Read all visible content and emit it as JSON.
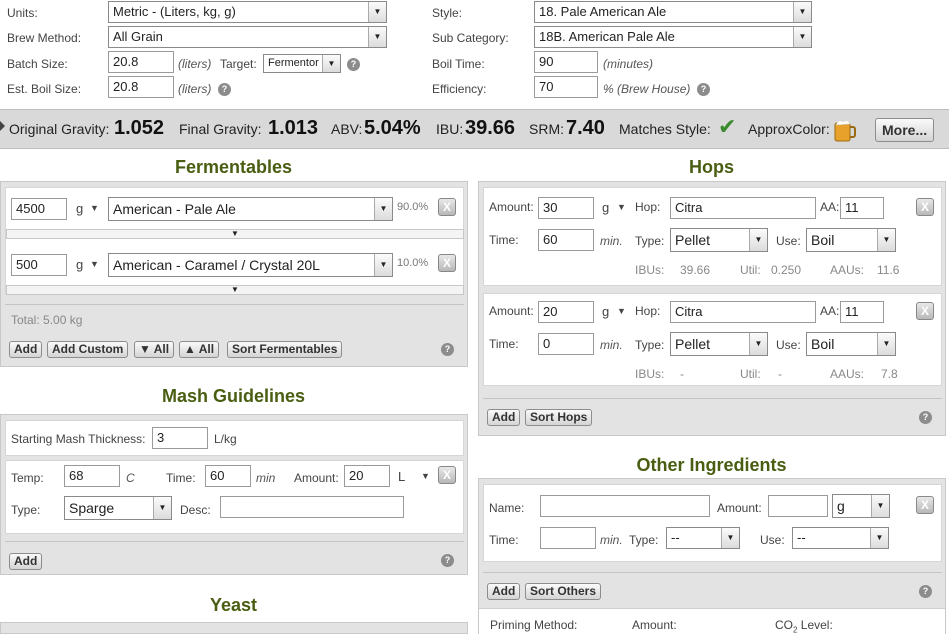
{
  "settings": {
    "units_label": "Units:",
    "units_value": "Metric - (Liters, kg, g)",
    "brew_method_label": "Brew Method:",
    "brew_method_value": "All Grain",
    "batch_size_label": "Batch Size:",
    "batch_size_value": "20.8",
    "batch_size_unit": "(liters)",
    "target_label": "Target:",
    "target_value": "Fermentor",
    "boil_size_label": "Est. Boil Size:",
    "boil_size_value": "20.8",
    "boil_size_unit": "(liters)",
    "style_label": "Style:",
    "style_value": "18. Pale American Ale",
    "subcategory_label": "Sub Category:",
    "subcategory_value": "18B. American Pale Ale",
    "boil_time_label": "Boil Time:",
    "boil_time_value": "90",
    "boil_time_unit": "(minutes)",
    "efficiency_label": "Efficiency:",
    "efficiency_value": "70",
    "efficiency_unit": "% (Brew House)"
  },
  "stats": {
    "og_label": "Original Gravity:",
    "og_value": "1.052",
    "fg_label": "Final Gravity:",
    "fg_value": "1.013",
    "abv_label": "ABV:",
    "abv_value": "5.04%",
    "ibu_label": "IBU:",
    "ibu_value": "39.66",
    "srm_label": "SRM:",
    "srm_value": "7.40",
    "matches_label": "Matches Style:",
    "color_label": "ApproxColor:",
    "more_label": "More..."
  },
  "fermentables": {
    "title": "Fermentables",
    "items": [
      {
        "amount": "4500",
        "unit": "g",
        "name": "American - Pale Ale",
        "percent": "90.0%"
      },
      {
        "amount": "500",
        "unit": "g",
        "name": "American - Caramel / Crystal 20L",
        "percent": "10.0%"
      }
    ],
    "total": "Total: 5.00 kg",
    "add_label": "Add",
    "add_custom_label": "Add Custom",
    "collapse_all_label": "▼ All",
    "expand_all_label": "▲ All",
    "sort_label": "Sort Fermentables"
  },
  "mash": {
    "title": "Mash Guidelines",
    "thickness_label": "Starting Mash Thickness:",
    "thickness_value": "3",
    "thickness_unit": "L/kg",
    "temp_label": "Temp:",
    "temp_value": "68",
    "temp_unit": "C",
    "time_label": "Time:",
    "time_value": "60",
    "time_unit": "min",
    "amount_label": "Amount:",
    "amount_value": "20",
    "amount_unit": "L",
    "type_label": "Type:",
    "type_value": "Sparge",
    "desc_label": "Desc:",
    "desc_value": "",
    "add_label": "Add"
  },
  "yeast": {
    "title": "Yeast"
  },
  "hops": {
    "title": "Hops",
    "amount_label": "Amount:",
    "hop_label": "Hop:",
    "aa_label": "AA:",
    "time_label": "Time:",
    "min_label": "min.",
    "type_label": "Type:",
    "use_label": "Use:",
    "ibus_label": "IBUs:",
    "util_label": "Util:",
    "aaus_label": "AAUs:",
    "items": [
      {
        "amount": "30",
        "unit": "g",
        "name": "Citra",
        "aa": "11",
        "time": "60",
        "type": "Pellet",
        "use": "Boil",
        "ibus": "39.66",
        "util": "0.250",
        "aaus": "11.6"
      },
      {
        "amount": "20",
        "unit": "g",
        "name": "Citra",
        "aa": "11",
        "time": "0",
        "type": "Pellet",
        "use": "Boil",
        "ibus": "-",
        "util": "-",
        "aaus": "7.8"
      }
    ],
    "add_label": "Add",
    "sort_label": "Sort Hops"
  },
  "other": {
    "title": "Other Ingredients",
    "name_label": "Name:",
    "name_value": "",
    "amount_label": "Amount:",
    "amount_value": "",
    "amount_unit": "g",
    "time_label": "Time:",
    "time_value": "",
    "min_label": "min.",
    "type_label": "Type:",
    "type_value": "--",
    "use_label": "Use:",
    "use_value": "--",
    "add_label": "Add",
    "sort_label": "Sort Others",
    "priming_label": "Priming Method:",
    "priming_amount_label": "Amount:",
    "co2_label": "CO",
    "co2_sub": "2",
    "co2_suffix": " Level:"
  },
  "icons": {
    "help": "?",
    "remove": "X",
    "dropdown": "▼",
    "check": "✔"
  },
  "colors": {
    "heading": "#4a5e12",
    "check": "#3a8a2e",
    "beer": "#e8a12a"
  }
}
